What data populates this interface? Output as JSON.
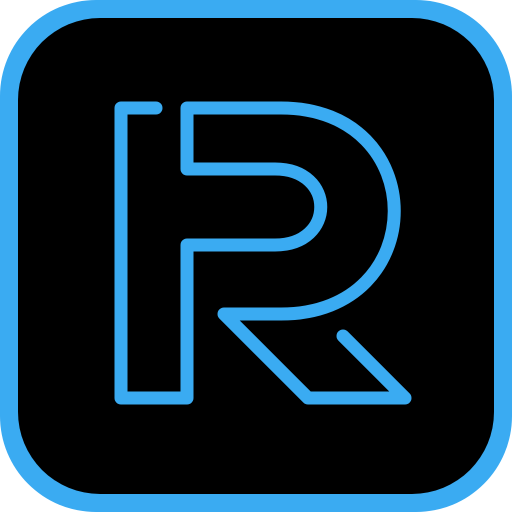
{
  "icon": {
    "name": "r-letter-logo-icon",
    "frame_color": "#3aabf2",
    "background_color": "#000000",
    "stroke_color": "#3aabf2"
  }
}
